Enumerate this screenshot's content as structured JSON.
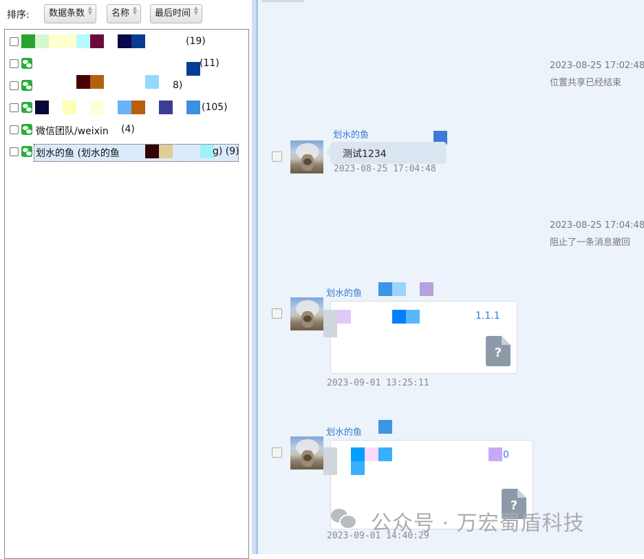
{
  "sort_bar": {
    "label": "排序:",
    "buttons": [
      "数据条数",
      "名称",
      "最后时间"
    ]
  },
  "contacts": [
    {
      "name": "",
      "count": "(19)"
    },
    {
      "name": "",
      "count": "(11)"
    },
    {
      "name": "",
      "count": "8)"
    },
    {
      "name": "",
      "count": "(105)"
    },
    {
      "name": "微信团队/weixin",
      "count": "(4)"
    },
    {
      "name": "划水的鱼  (划水的鱼",
      "count": "g) (9)"
    }
  ],
  "chat": {
    "system_messages": [
      {
        "time": "2023-08-25 17:02:48",
        "text": "位置共享已经结束"
      },
      {
        "time": "2023-08-25 17:04:48",
        "text": "阻止了一条消息撤回"
      }
    ],
    "messages": [
      {
        "sender": "划水的鱼",
        "type": "text",
        "text": "测试1234",
        "time": "2023-08-25 17:04:48"
      },
      {
        "sender": "划水的鱼",
        "type": "file",
        "file_label": "1.1.1",
        "time": "2023-09-01 13:25:11",
        "icon": "unknown-file-icon"
      },
      {
        "sender": "划水的鱼",
        "type": "file",
        "file_label": "0",
        "time": "2023-09-01 14:40:29",
        "icon": "unknown-file-icon"
      }
    ]
  },
  "watermark": {
    "text": "公众号 · 万宏蜀盾科技"
  },
  "colors": {
    "wechat_green": "#2aad3b",
    "link_blue": "#3b7bd0",
    "pane_bg": "#edf3fb"
  }
}
